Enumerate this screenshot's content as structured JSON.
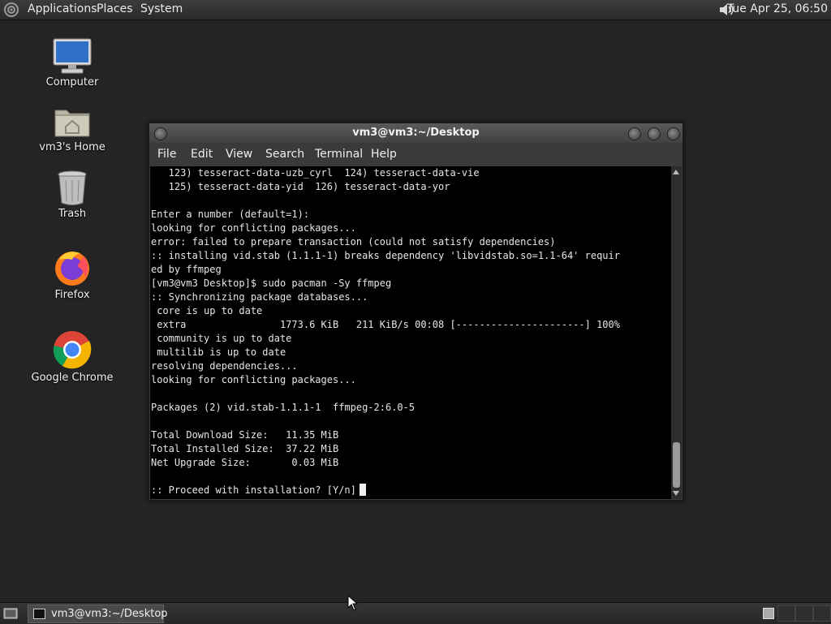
{
  "top_panel": {
    "menus": [
      "Applications",
      "Places",
      "System"
    ],
    "clock": "Tue Apr 25, 06:50",
    "volume_icon": "speaker-icon"
  },
  "desktop_icons": [
    {
      "label": "Computer",
      "icon": "computer-icon"
    },
    {
      "label": "vm3's Home",
      "icon": "home-folder-icon"
    },
    {
      "label": "Trash",
      "icon": "trash-icon"
    },
    {
      "label": "Firefox",
      "icon": "firefox-icon"
    },
    {
      "label": "Google Chrome",
      "icon": "chrome-icon"
    }
  ],
  "terminal": {
    "title": "vm3@vm3:~/Desktop",
    "menu": [
      "File",
      "Edit",
      "View",
      "Search",
      "Terminal",
      "Help"
    ],
    "lines": [
      "   123) tesseract-data-uzb_cyrl  124) tesseract-data-vie",
      "   125) tesseract-data-yid  126) tesseract-data-yor",
      "",
      "Enter a number (default=1):",
      "looking for conflicting packages...",
      "error: failed to prepare transaction (could not satisfy dependencies)",
      ":: installing vid.stab (1.1.1-1) breaks dependency 'libvidstab.so=1.1-64' requir",
      "ed by ffmpeg",
      "[vm3@vm3 Desktop]$ sudo pacman -Sy ffmpeg",
      ":: Synchronizing package databases...",
      " core is up to date",
      " extra                1773.6 KiB   211 KiB/s 00:08 [----------------------] 100%",
      " community is up to date",
      " multilib is up to date",
      "resolving dependencies...",
      "looking for conflicting packages...",
      "",
      "Packages (2) vid.stab-1.1.1-1  ffmpeg-2:6.0-5",
      "",
      "Total Download Size:   11.35 MiB",
      "Total Installed Size:  37.22 MiB",
      "Net Upgrade Size:       0.03 MiB",
      "",
      ":: Proceed with installation? [Y/n]"
    ]
  },
  "taskbar": {
    "task_label": "vm3@vm3:~/Desktop"
  }
}
